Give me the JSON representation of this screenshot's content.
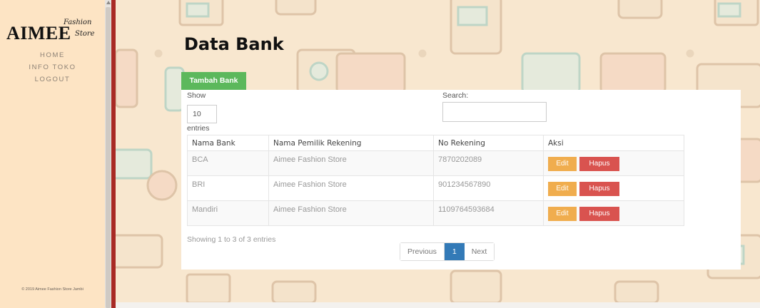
{
  "sidebar": {
    "brand_main": "AIMEE",
    "brand_sub1": "Fashion",
    "brand_sub2": "Store",
    "nav": [
      {
        "label": "HOME"
      },
      {
        "label": "INFO TOKO"
      },
      {
        "label": "LOGOUT"
      }
    ],
    "footer": "© 2019 Aimee Fashion Store Jambi"
  },
  "page": {
    "title": "Data Bank",
    "add_button": "Tambah Bank"
  },
  "datatable": {
    "show_label": "Show",
    "show_value": "10",
    "entries_label": "entries",
    "search_label": "Search:",
    "search_value": "",
    "columns": [
      "Nama Bank",
      "Nama Pemilik Rekening",
      "No Rekening",
      "Aksi"
    ],
    "rows": [
      {
        "bank": "BCA",
        "owner": "Aimee Fashion Store",
        "number": "7870202089",
        "edit": "Edit",
        "delete": "Hapus"
      },
      {
        "bank": "BRI",
        "owner": "Aimee Fashion Store",
        "number": "901234567890",
        "edit": "Edit",
        "delete": "Hapus"
      },
      {
        "bank": "Mandiri",
        "owner": "Aimee Fashion Store",
        "number": "1109764593684",
        "edit": "Edit",
        "delete": "Hapus"
      }
    ],
    "info": "Showing 1 to 3 of 3 entries",
    "pagination": {
      "previous": "Previous",
      "current": "1",
      "next": "Next"
    }
  },
  "colors": {
    "sidebar_bg": "#fde4c4",
    "accent_red": "#a82a25",
    "add_green": "#5cb85c",
    "edit_orange": "#f0ad4e",
    "delete_red": "#d9534f",
    "page_active": "#337ab7"
  }
}
